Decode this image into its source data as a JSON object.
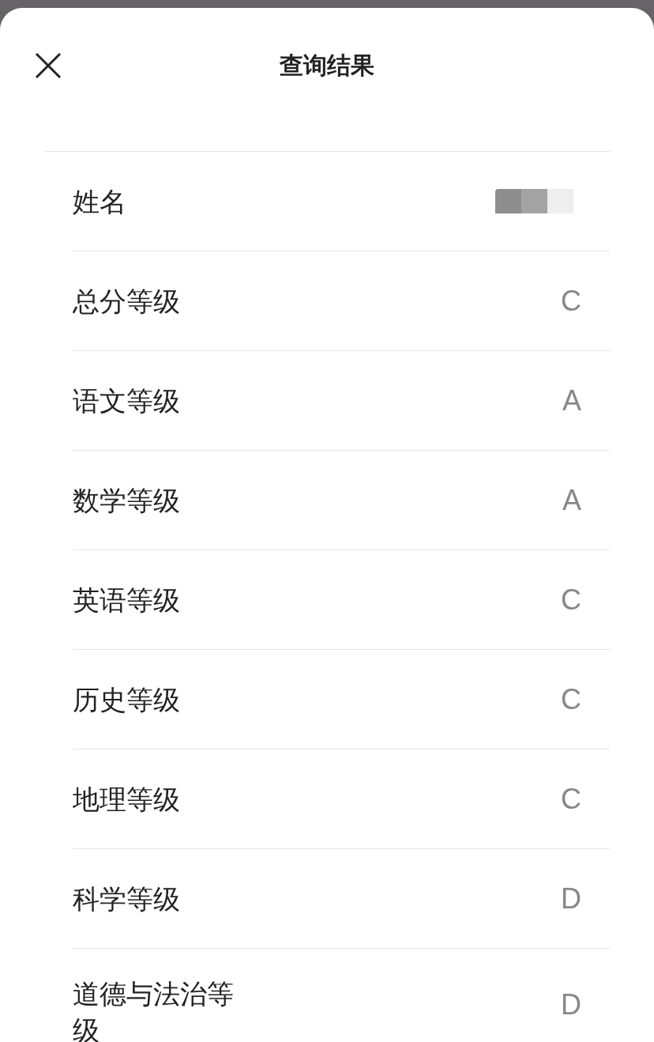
{
  "header": {
    "title": "查询结果"
  },
  "rows": [
    {
      "label": "姓名",
      "kind": "redacted"
    },
    {
      "label": "总分等级",
      "kind": "text",
      "value": "C"
    },
    {
      "label": "语文等级",
      "kind": "text",
      "value": "A"
    },
    {
      "label": "数学等级",
      "kind": "text",
      "value": "A"
    },
    {
      "label": "英语等级",
      "kind": "text",
      "value": "C"
    },
    {
      "label": "历史等级",
      "kind": "text",
      "value": "C"
    },
    {
      "label": "地理等级",
      "kind": "text",
      "value": "C"
    },
    {
      "label": "科学等级",
      "kind": "text",
      "value": "D"
    },
    {
      "label": "道德与法治等级",
      "kind": "text",
      "value": "D"
    }
  ]
}
